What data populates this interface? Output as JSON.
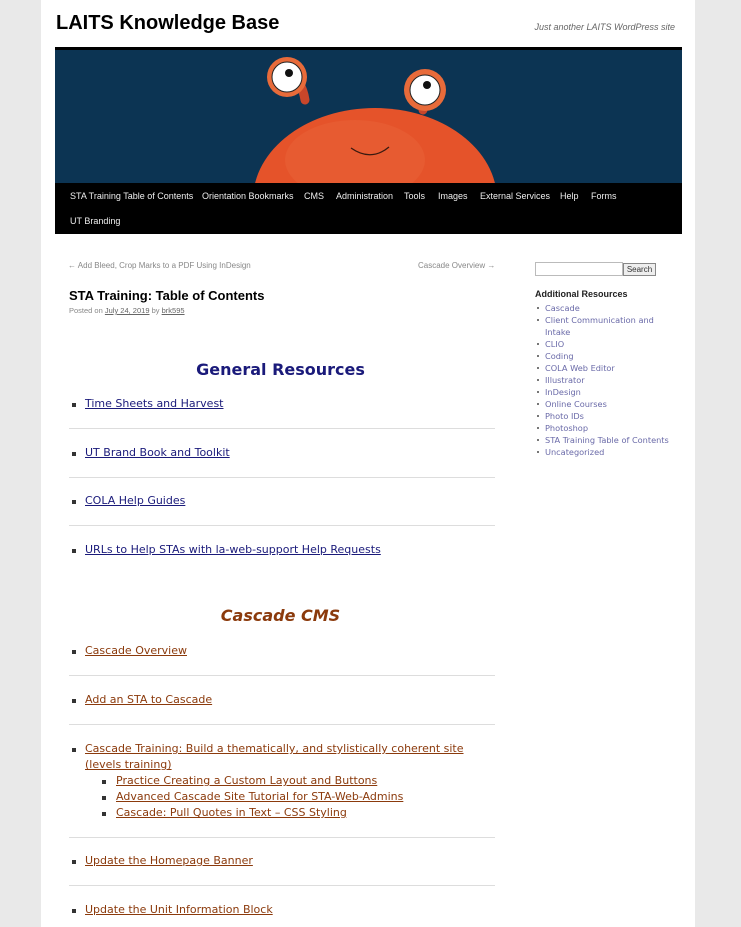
{
  "site": {
    "title": "LAITS Knowledge Base",
    "description": "Just another LAITS WordPress site"
  },
  "nav": {
    "items": [
      "STA Training Table of Contents",
      "Orientation Bookmarks",
      "CMS",
      "Administration",
      "Tools",
      "Images",
      "External Services",
      "Help",
      "Forms",
      "UT Branding"
    ]
  },
  "post_nav": {
    "prev": "← Add Bleed, Crop Marks to a PDF Using InDesign",
    "next": "Cascade Overview →"
  },
  "entry": {
    "title": "STA Training: Table of Contents",
    "meta_prefix": "Posted on",
    "date": "July 24, 2019",
    "meta_by": "by",
    "author": "brk595"
  },
  "general": {
    "heading": "General Resources",
    "links": [
      "Time Sheets and Harvest",
      "UT Brand Book and Toolkit",
      "COLA Help Guides",
      "URLs to Help STAs with la-web-support Help Requests"
    ]
  },
  "cascade": {
    "heading": "Cascade CMS",
    "links": [
      "Cascade Overview",
      "Add an STA to Cascade",
      "Cascade Training: Build a thematically, and stylistically coherent site (levels training)",
      "Update the Homepage Banner",
      "Update the Unit Information Block"
    ],
    "sublinks": [
      "Practice Creating a Custom Layout and Buttons",
      "Advanced Cascade Site Tutorial for STA-Web-Admins",
      "Cascade: Pull Quotes in Text – CSS Styling"
    ]
  },
  "sidebar": {
    "search_button": "Search",
    "search_value": "",
    "widget_title": "Additional Resources",
    "categories": [
      "Cascade",
      "Client Communication and Intake",
      "CLIO",
      "Coding",
      "COLA Web Editor",
      "Illustrator",
      "InDesign",
      "Online Courses",
      "Photo IDs",
      "Photoshop",
      "STA Training Table of Contents",
      "Uncategorized"
    ]
  },
  "colors": {
    "banner_bg": "#0c3453",
    "crab": "#e5532a",
    "general_link": "#1a1a7a",
    "cascade_link": "#8b3a0c"
  }
}
